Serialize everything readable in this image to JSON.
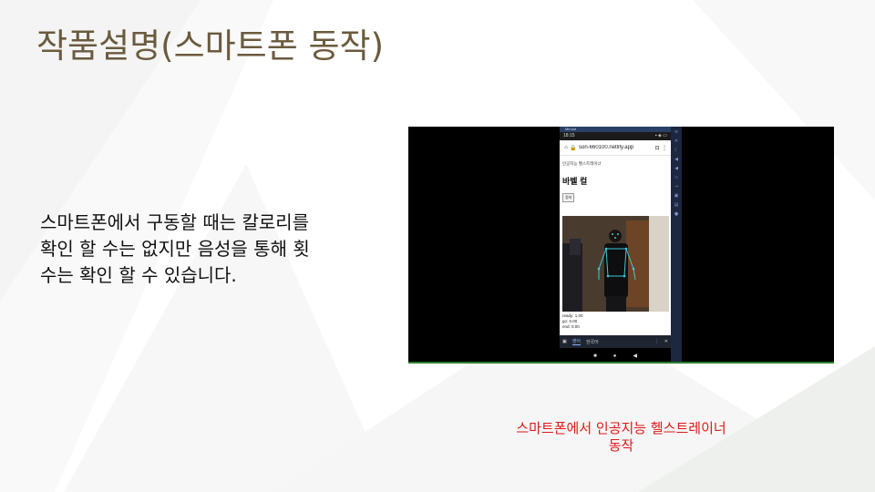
{
  "slide": {
    "title": "작품설명(스마트폰 동작)",
    "body_lines": [
      "스마트폰에서 구동할 때는 칼로리를",
      "확인 할 수는 없지만 음성을 통해 횟",
      "수는 확인 할 수 있습니다."
    ],
    "caption_lines": [
      "스마트폰에서 인공지능 헬스트레이너",
      "동작"
    ]
  },
  "phone": {
    "topbar_label": "Mirroid",
    "status_time": "18:15",
    "status_right": "▪ ◈ ▭",
    "url": "son-660100.netlify.app",
    "page_small_title": "인공지능 헬스트레이너",
    "page_heading": "바벨 컬",
    "stop_button": "정지",
    "readouts": [
      "ready: 1.00",
      "go: 0.00",
      "end: 0.00"
    ],
    "bottom_tabs": [
      "영어",
      "한국어"
    ],
    "nav_glyphs": [
      "■",
      "●",
      "◀"
    ]
  },
  "colors": {
    "title": "#6b5a3e",
    "caption": "#e01a1a",
    "frame": "#000000",
    "pose_lines": "#3fc8d8"
  },
  "icons": {
    "home": "home-icon",
    "lock": "lock-icon",
    "tabs": "tabs-icon",
    "menu": "more-vert-icon",
    "close": "close-icon"
  }
}
